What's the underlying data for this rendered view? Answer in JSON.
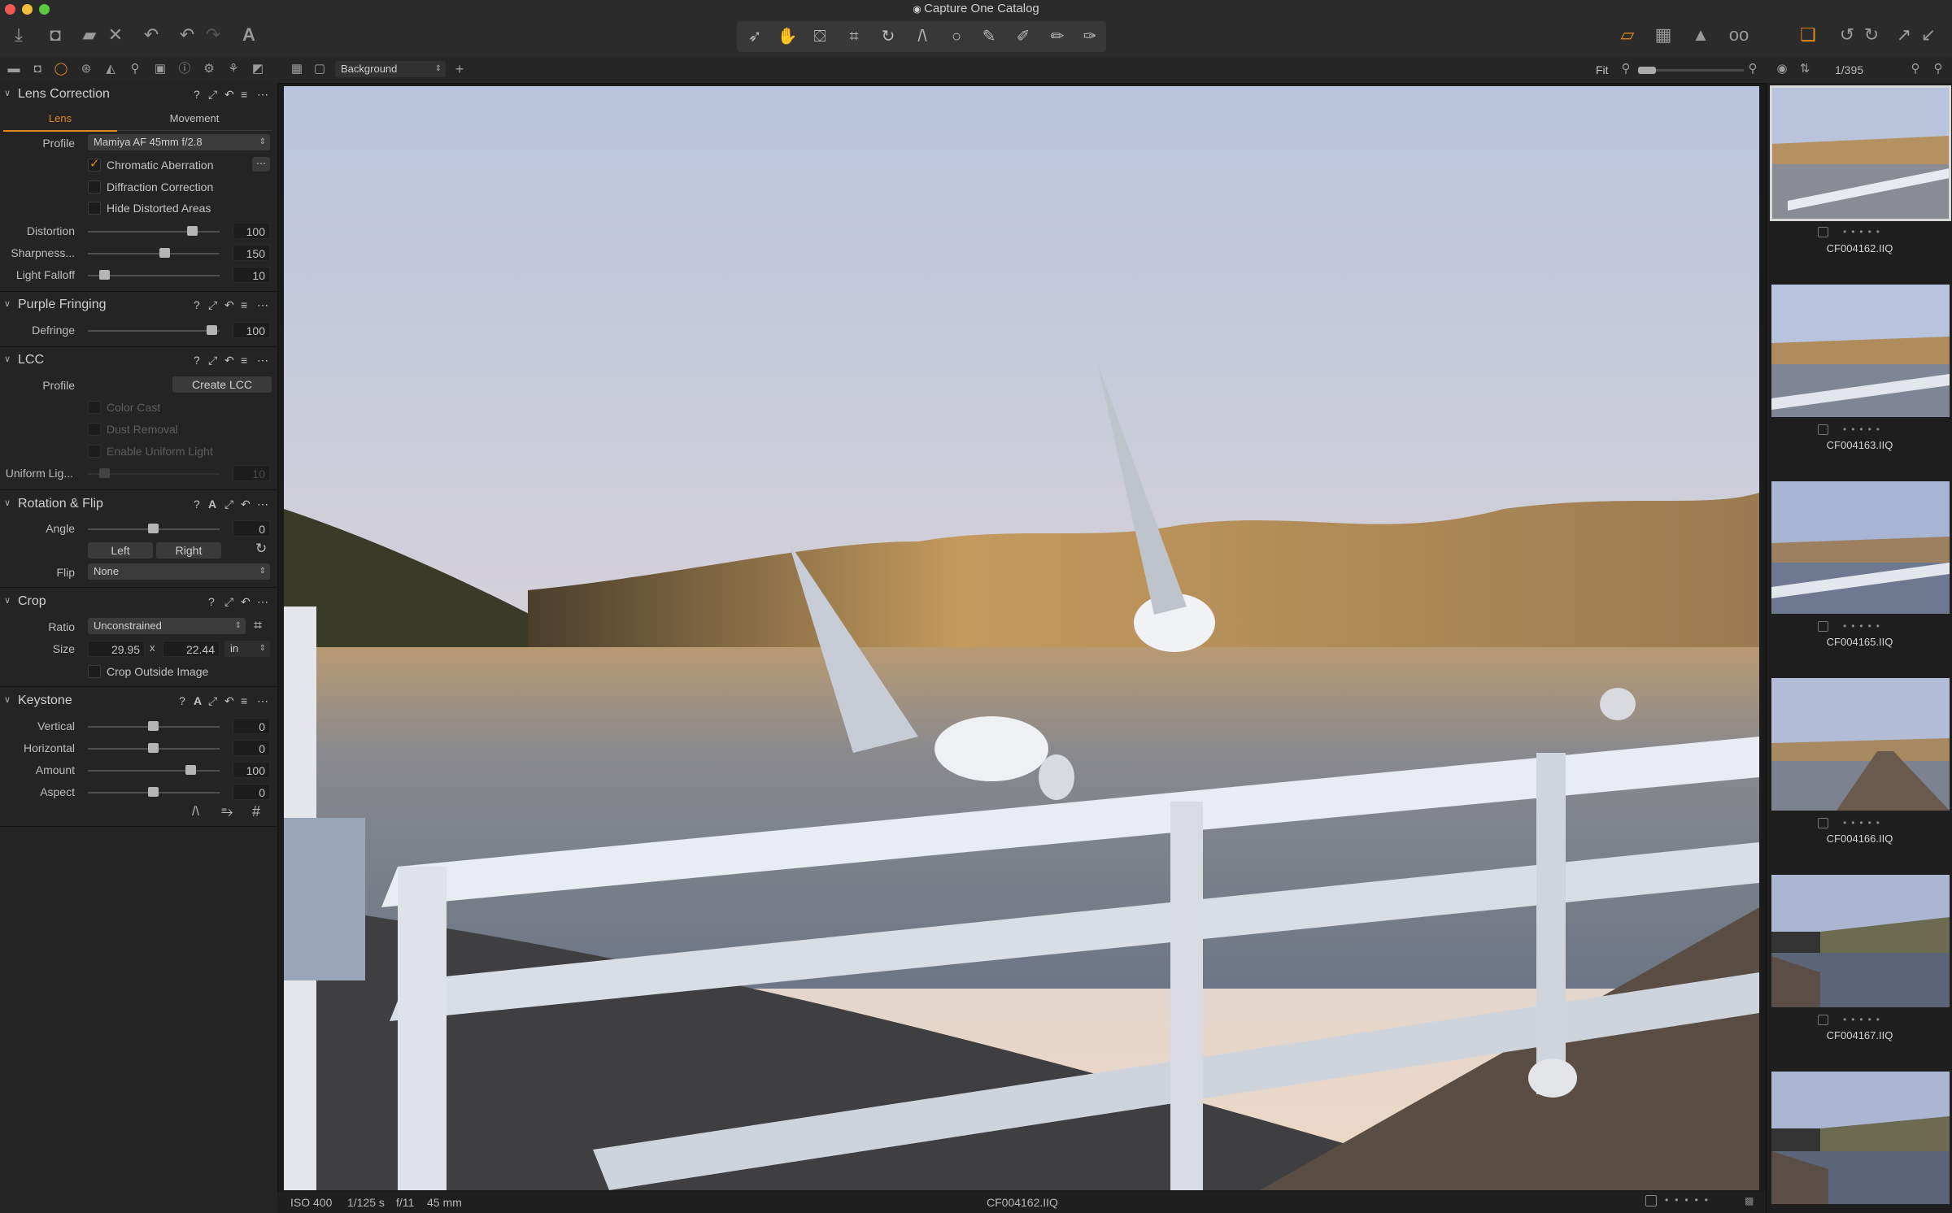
{
  "window": {
    "title": "Capture One Catalog"
  },
  "toolbar": {
    "left_icons": [
      "import-icon",
      "camera-icon",
      "export-icon",
      "delete-icon",
      "undo-history-icon",
      "undo-icon",
      "redo-icon",
      "text-icon"
    ],
    "right_icons": [
      "edit-mode-icon",
      "grid-icon",
      "warning-icon",
      "loupe-glasses-icon",
      "layers-icon",
      "rotate-left-icon",
      "rotate-right-icon",
      "expand-icon",
      "collapse-icon"
    ]
  },
  "viewer_bar": {
    "layer": "Background",
    "zoom": "Fit",
    "counter": "1/395"
  },
  "lens_correction": {
    "title": "Lens Correction",
    "tabs": [
      "Lens",
      "Movement"
    ],
    "profile_label": "Profile",
    "profile": "Mamiya AF 45mm f/2.8",
    "checks": [
      {
        "label": "Chromatic Aberration",
        "checked": true
      },
      {
        "label": "Diffraction Correction",
        "checked": false
      },
      {
        "label": "Hide Distorted Areas",
        "checked": false
      }
    ],
    "sliders": [
      {
        "label": "Distortion",
        "value": "100",
        "pos": 0.73
      },
      {
        "label": "Sharpness...",
        "value": "150",
        "pos": 0.54
      },
      {
        "label": "Light Falloff",
        "value": "10",
        "pos": 0.11
      }
    ]
  },
  "purple_fringing": {
    "title": "Purple Fringing",
    "slider": {
      "label": "Defringe",
      "value": "100",
      "pos": 0.95
    }
  },
  "lcc": {
    "title": "LCC",
    "profile_label": "Profile",
    "create_button": "Create LCC",
    "checks": [
      "Color Cast",
      "Dust Removal",
      "Enable Uniform Light"
    ],
    "slider": {
      "label": "Uniform Lig...",
      "value": "10",
      "pos": 0.11
    }
  },
  "rotation": {
    "title": "Rotation & Flip",
    "angle_label": "Angle",
    "angle_value": "0",
    "left": "Left",
    "right": "Right",
    "flip_label": "Flip",
    "flip": "None"
  },
  "crop": {
    "title": "Crop",
    "ratio_label": "Ratio",
    "ratio": "Unconstrained",
    "size_label": "Size",
    "width": "29.95",
    "x": "x",
    "height": "22.44",
    "unit": "in",
    "outside_label": "Crop Outside Image"
  },
  "keystone": {
    "title": "Keystone",
    "sliders": [
      {
        "label": "Vertical",
        "value": "0",
        "pos": 0.5
      },
      {
        "label": "Horizontal",
        "value": "0",
        "pos": 0.5
      },
      {
        "label": "Amount",
        "value": "100",
        "pos": 0.78
      },
      {
        "label": "Aspect",
        "value": "0",
        "pos": 0.5
      }
    ]
  },
  "status": {
    "iso": "ISO 400",
    "shutter": "1/125 s",
    "aperture": "f/11",
    "focal": "45 mm",
    "filename": "CF004162.IIQ"
  },
  "thumbnails": [
    "CF004162.IIQ",
    "CF004163.IIQ",
    "CF004165.IIQ",
    "CF004166.IIQ",
    "CF004167.IIQ",
    ""
  ],
  "colors": {
    "accent": "#e08a1e",
    "panel": "#242424",
    "sky_top": "#b9c4dc",
    "sky_bottom": "#e8d6c8"
  }
}
